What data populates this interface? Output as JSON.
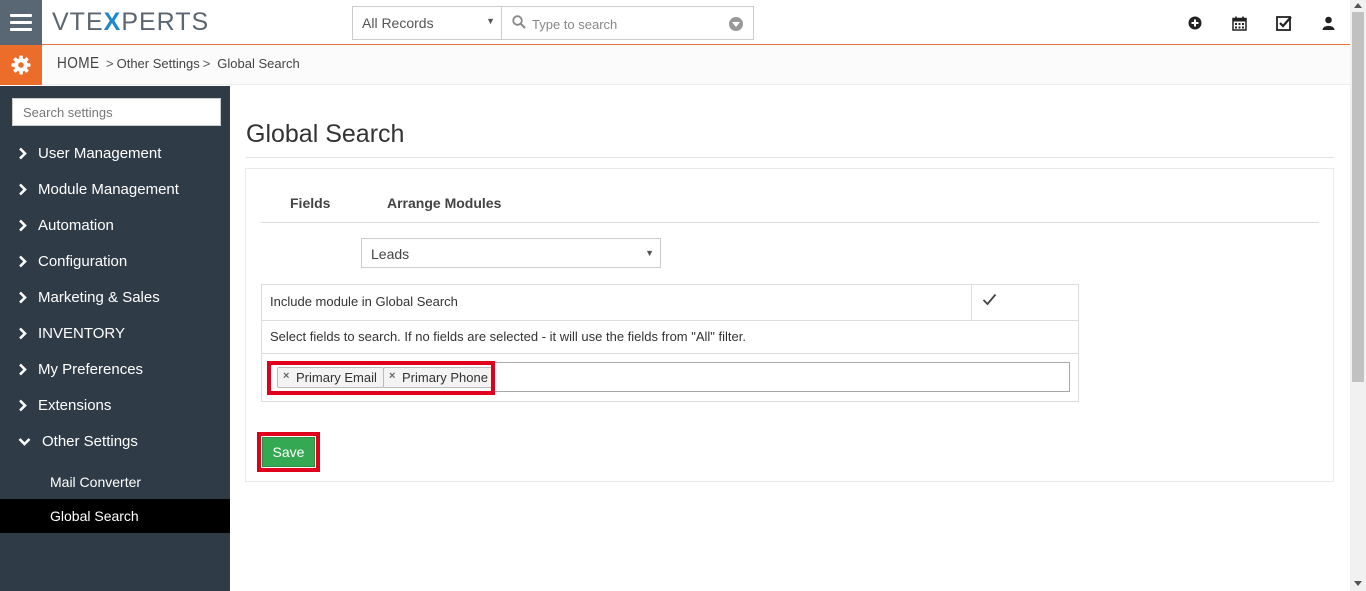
{
  "header": {
    "logo_pre": "VTE",
    "logo_x": "X",
    "logo_post": "PERTS",
    "records_select": "All Records",
    "search_placeholder": "Type to search"
  },
  "breadcrumb": {
    "home": "HOME",
    "sep1": ">",
    "item1": "Other Settings",
    "sep2": ">",
    "item2": "Global Search"
  },
  "sidebar": {
    "search_placeholder": "Search settings",
    "items": [
      {
        "label": "User Management"
      },
      {
        "label": "Module Management"
      },
      {
        "label": "Automation"
      },
      {
        "label": "Configuration"
      },
      {
        "label": "Marketing & Sales"
      },
      {
        "label": "INVENTORY"
      },
      {
        "label": "My Preferences"
      },
      {
        "label": "Extensions"
      },
      {
        "label": "Other Settings"
      }
    ],
    "subitems": [
      {
        "label": "Mail Converter"
      },
      {
        "label": "Global Search"
      }
    ]
  },
  "main": {
    "title": "Global Search",
    "tabs": [
      {
        "label": "Fields"
      },
      {
        "label": "Arrange Modules"
      }
    ],
    "module_select": "Leads",
    "include_label": "Include module in Global Search",
    "include_checked": true,
    "fields_help": "Select fields to search. If no fields are selected - it will use the fields from \"All\" filter.",
    "selected_fields": [
      {
        "label": "Primary Email"
      },
      {
        "label": "Primary Phone"
      }
    ],
    "save_label": "Save"
  },
  "colors": {
    "accent": "#ec6c29",
    "sidebar_bg": "#2f3b47",
    "save_green": "#34a853",
    "highlight_red": "#e0001b"
  }
}
